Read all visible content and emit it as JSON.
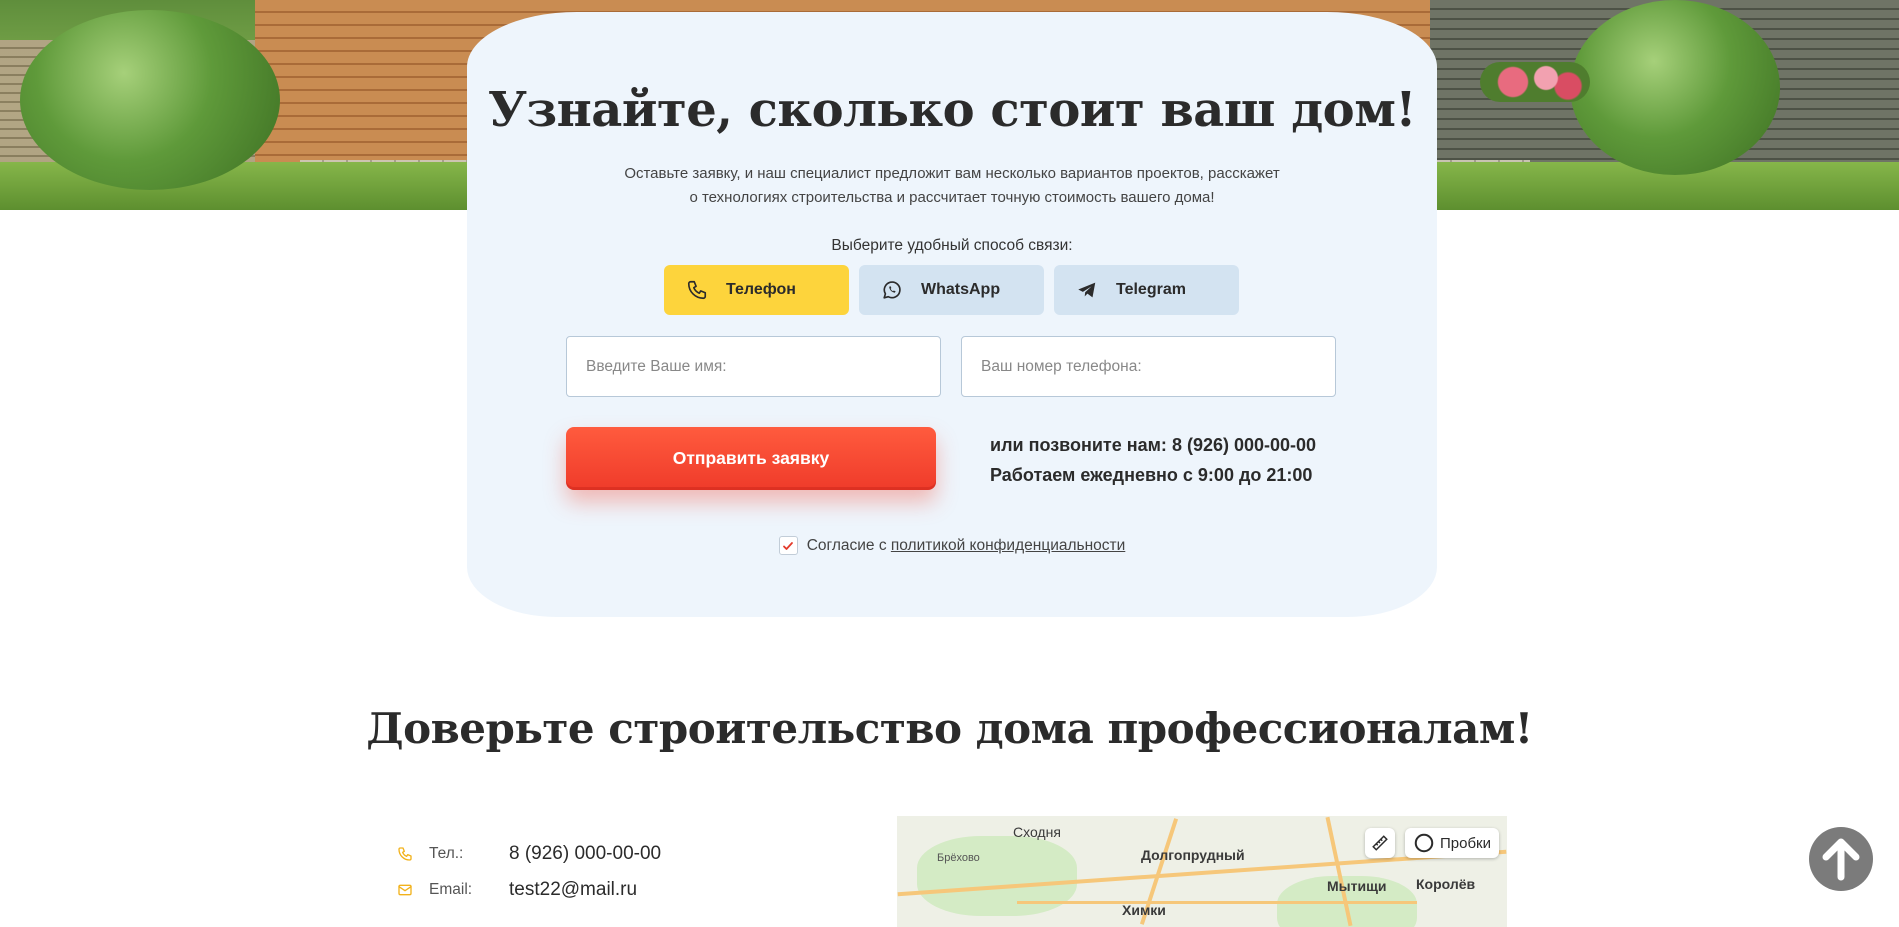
{
  "hero": {
    "title_regular_1": "Узнайте,",
    "title_bold": "сколько стоит",
    "title_regular_2": "ваш дом!",
    "subtitle_line1": "Оставьте заявку, и наш специалист предложит вам несколько вариантов проектов, расскажет",
    "subtitle_line2": "о технологиях строительства и рассчитает точную стоимость вашего дома!"
  },
  "contact_method": {
    "label": "Выберите удобный способ связи:",
    "options": [
      {
        "label": "Телефон",
        "icon": "phone-icon",
        "selected": true
      },
      {
        "label": "WhatsApp",
        "icon": "whatsapp-icon",
        "selected": false
      },
      {
        "label": "Telegram",
        "icon": "telegram-icon",
        "selected": false
      }
    ],
    "selected_color": "#FDD43C",
    "default_color": "#D3E3F1"
  },
  "form": {
    "name_placeholder": "Введите Ваше имя:",
    "phone_placeholder": "Ваш номер телефона:",
    "submit_label": "Отправить заявку",
    "submit_color": "#F4442E",
    "call_prefix": "или позвоните нам: ",
    "call_phone": "8 (926) 000-00-00",
    "hours": "Работаем ежедневно с 9:00 до 21:00",
    "consent_text": "Согласие с ",
    "consent_link": "политикой конфиденциальности",
    "consent_checked": true
  },
  "trust": {
    "title_regular": "Доверьте строительство дома ",
    "title_bold": "профессионалам!",
    "contacts": [
      {
        "icon": "phone-icon",
        "label": "Тел.:",
        "value": "8 (926) 000-00-00"
      },
      {
        "icon": "mail-icon",
        "label": "Email:",
        "value": "test22@mail.ru"
      }
    ]
  },
  "map": {
    "traffic_label": "Пробки",
    "places": [
      "Сходня",
      "Брёхово",
      "Долгопрудный",
      "Мытищи",
      "Королёв",
      "Химки"
    ]
  }
}
